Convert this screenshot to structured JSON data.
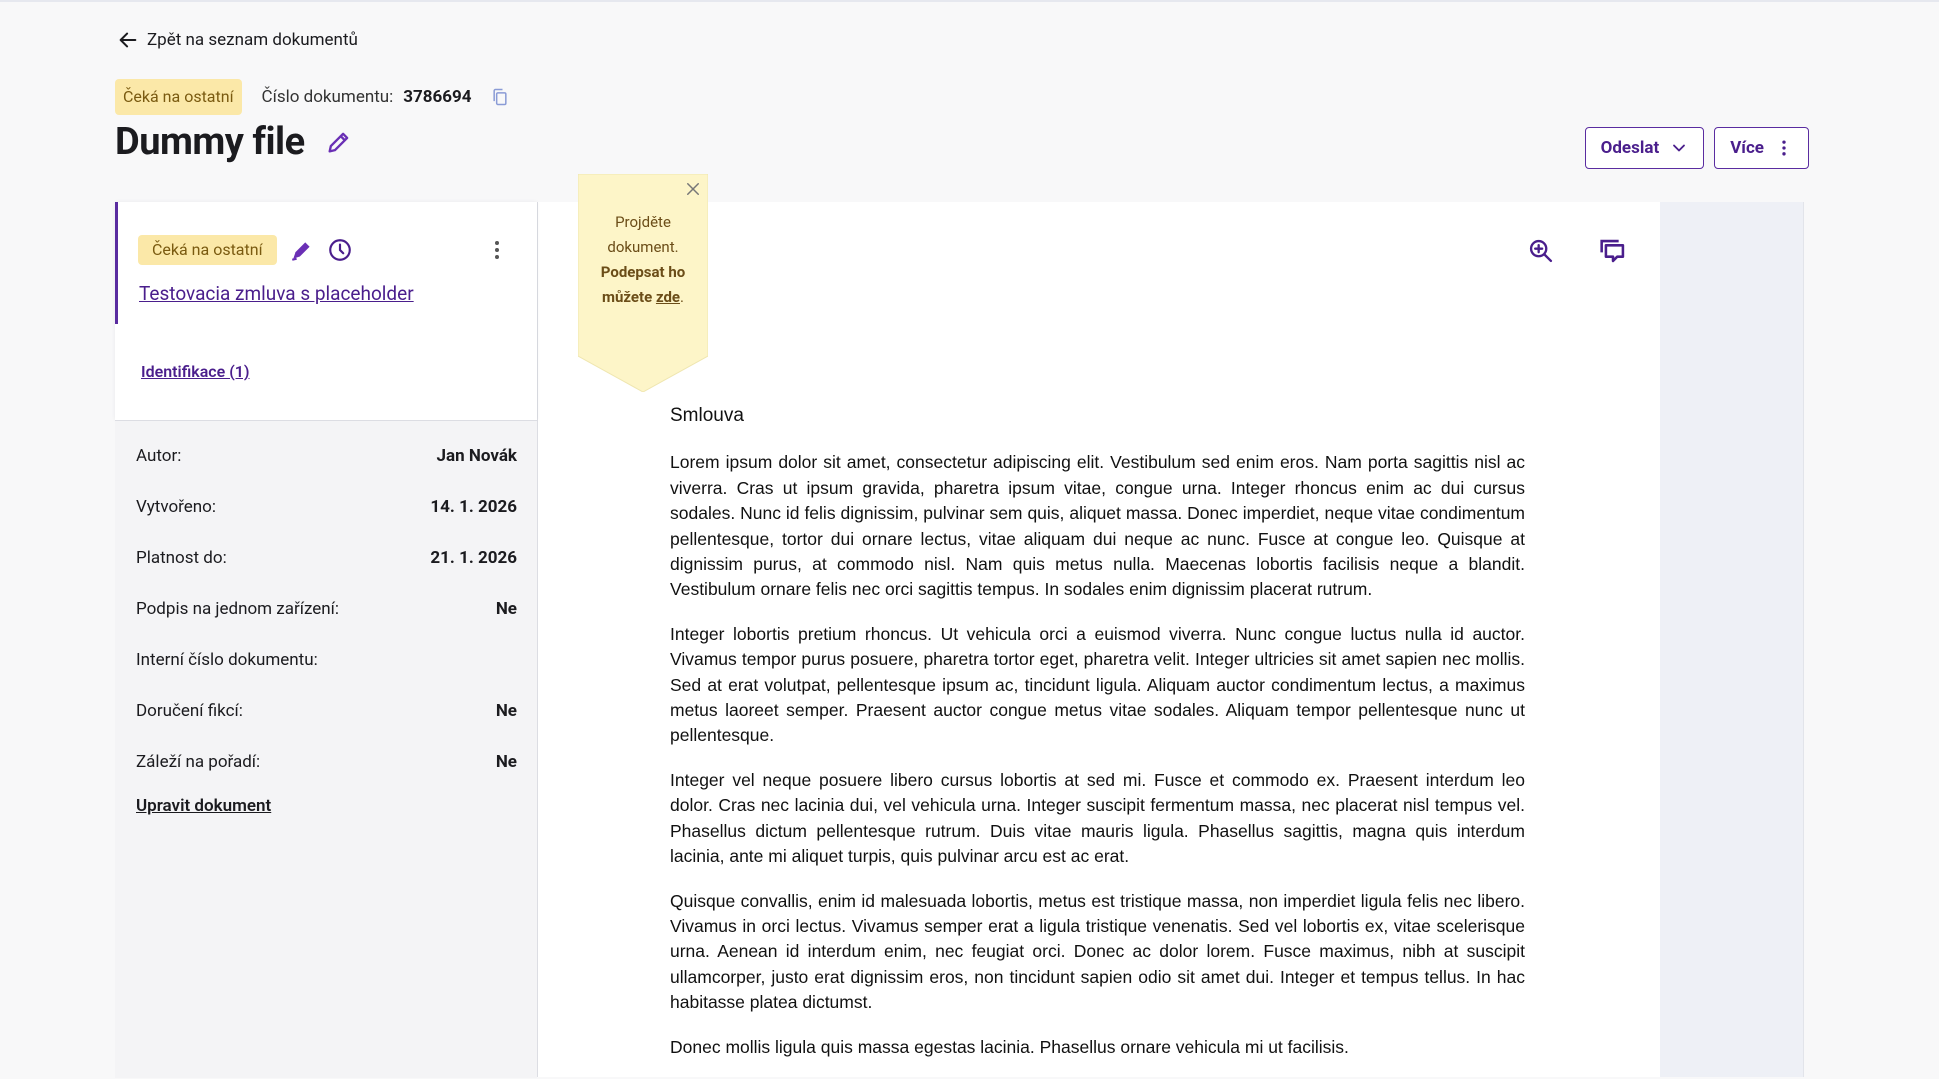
{
  "nav": {
    "back_label": "Zpět na seznam dokumentů"
  },
  "header": {
    "status_badge": "Čeká na ostatní",
    "doc_number_label": "Číslo dokumentu:",
    "doc_number_value": "3786694",
    "title": "Dummy file"
  },
  "actions": {
    "send_label": "Odeslat",
    "more_label": "Více"
  },
  "card": {
    "status_badge": "Čeká na ostatní",
    "doc_name": "Testovacia zmluva s placeholder",
    "identification_link": "Identifikace (1)"
  },
  "info": {
    "rows": [
      {
        "label": "Autor:",
        "value": "Jan Novák"
      },
      {
        "label": "Vytvořeno:",
        "value": "14. 1. 2026"
      },
      {
        "label": "Platnost do:",
        "value": "21. 1. 2026"
      },
      {
        "label": "Podpis na jednom zařízení:",
        "value": "Ne"
      },
      {
        "label": "Interní číslo dokumentu:",
        "value": ""
      },
      {
        "label": "Doručení fikcí:",
        "value": "Ne"
      },
      {
        "label": "Záleží na pořadí:",
        "value": "Ne"
      }
    ],
    "edit_link": "Upravit dokument"
  },
  "tooltip": {
    "line1": "Projděte dokument.",
    "line2": "Podepsat ho můžete",
    "link": "zde",
    "end": "."
  },
  "document": {
    "title": "Smlouva",
    "paragraphs": [
      "Lorem ipsum dolor sit amet, consectetur adipiscing elit. Vestibulum sed enim eros. Nam porta sagittis nisl ac viverra. Cras ut ipsum gravida, pharetra ipsum vitae, congue urna. Integer rhoncus enim ac dui cursus sodales. Nunc id felis dignissim, pulvinar sem quis, aliquet massa. Donec imperdiet, neque vitae condimentum pellentesque, tortor dui ornare lectus, vitae aliquam dui neque ac nunc. Fusce at congue leo. Quisque at dignissim purus, at commodo nisl. Nam quis metus nulla. Maecenas lobortis facilisis neque a blandit. Vestibulum ornare felis nec orci sagittis tempus. In sodales enim dignissim placerat rutrum.",
      "Integer lobortis pretium rhoncus. Ut vehicula orci a euismod viverra. Nunc congue luctus nulla id auctor. Vivamus tempor purus posuere, pharetra tortor eget, pharetra velit. Integer ultricies sit amet sapien nec mollis. Sed at erat volutpat, pellentesque ipsum ac, tincidunt ligula. Aliquam auctor condimentum lectus, a maximus metus laoreet semper. Praesent auctor congue metus vitae sodales. Aliquam tempor pellentesque nunc ut pellentesque.",
      "Integer vel neque posuere libero cursus lobortis at sed mi. Fusce et commodo ex. Praesent interdum leo dolor. Cras nec lacinia dui, vel vehicula urna. Integer suscipit fermentum massa, nec placerat nisl tempus vel. Phasellus dictum pellentesque rutrum. Duis vitae mauris ligula. Phasellus sagittis, magna quis interdum lacinia, ante mi aliquet turpis, quis pulvinar arcu est ac erat.",
      "Quisque convallis, enim id malesuada lobortis, metus est tristique massa, non imperdiet ligula felis nec libero. Vivamus in orci lectus. Vivamus semper erat a ligula tristique venenatis. Sed vel lobortis ex, vitae scelerisque urna. Aenean id interdum enim, nec feugiat orci. Donec ac dolor lorem. Fusce maximus, nibh at suscipit ullamcorper, justo erat dignissim eros, non tincidunt sapien odio sit amet dui. Integer et tempus tellus. In hac habitasse platea dictumst.",
      "Donec mollis ligula quis massa egestas lacinia. Phasellus ornare vehicula mi ut facilisis."
    ]
  },
  "colors": {
    "accent": "#4a1e8c",
    "badge_bg": "#fbe8a8",
    "tooltip_bg": "#fdf5c8"
  }
}
